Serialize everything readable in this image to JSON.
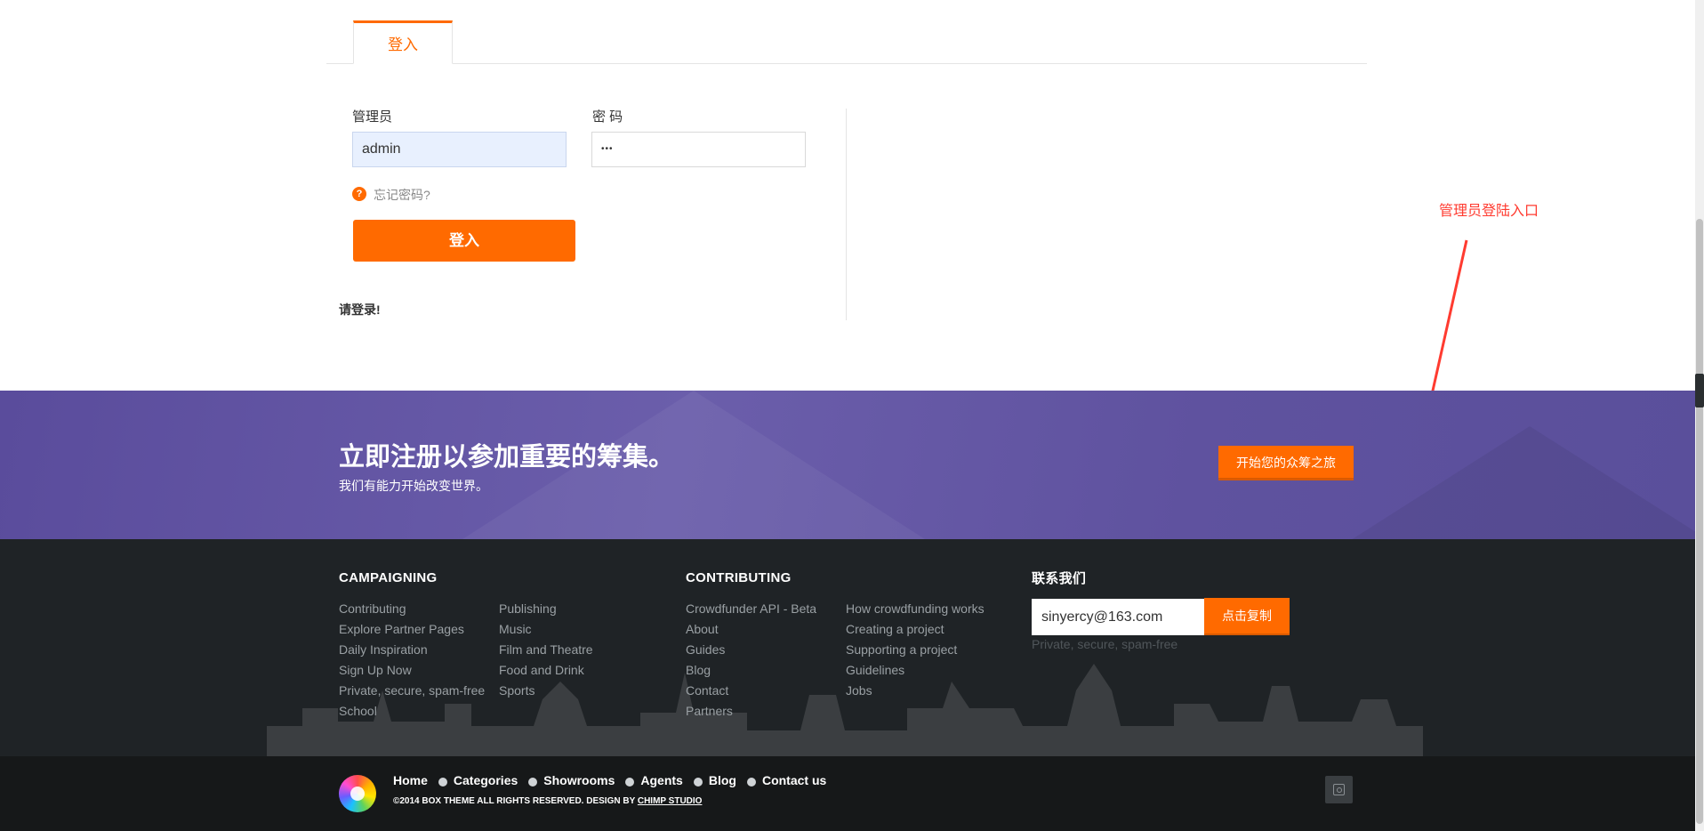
{
  "login": {
    "tab_label": "登入",
    "username_label": "管理员",
    "username_value": "admin",
    "password_label": "密 码",
    "password_value": "•••",
    "help_symbol": "?",
    "forgot_label": "忘记密码?",
    "login_button": "登入",
    "message": "请登录!",
    "annotation": "管理员登陆入口"
  },
  "cta": {
    "title": "立即注册以参加重要的筹集。",
    "subtitle": "我们有能力开始改变世界。",
    "button": "开始您的众筹之旅"
  },
  "footer": {
    "campaigning": {
      "heading": "CAMPAIGNING",
      "col1": [
        "Contributing",
        "Explore Partner Pages",
        "Daily Inspiration",
        "Sign Up Now",
        "Private, secure, spam-free",
        "School"
      ],
      "col2": [
        "Publishing",
        "Music",
        "Film and Theatre",
        "Food and Drink",
        "Sports"
      ]
    },
    "contributing": {
      "heading": "CONTRIBUTING",
      "col1": [
        "Crowdfunder API - Beta",
        "About",
        "Guides",
        "Blog",
        "Contact",
        "Partners"
      ],
      "col2": [
        "How crowdfunding works",
        "Creating a project",
        "Supporting a project",
        "Guidelines",
        "Jobs"
      ]
    },
    "contact": {
      "heading": "联系我们",
      "email": "sinyercy@163.com",
      "copy_button": "点击复制",
      "note": "Private, secure, spam-free"
    }
  },
  "bottom": {
    "nav": [
      "Home",
      "Categories",
      "Showrooms",
      "Agents",
      "Blog",
      "Contact us"
    ],
    "copyright_text": "©2014 BOX THEME ALL RIGHTS RESERVED. DESIGN BY ",
    "copyright_link": "CHIMP STUDIO"
  },
  "colors": {
    "accent": "#ff6a00",
    "cta_band": "#5f529f",
    "footer_bg": "#1f2326",
    "bottom_bg": "#161819",
    "annotation": "#ff3b30"
  },
  "icons": [
    "help-icon",
    "instagram-icon",
    "logo-icon"
  ]
}
